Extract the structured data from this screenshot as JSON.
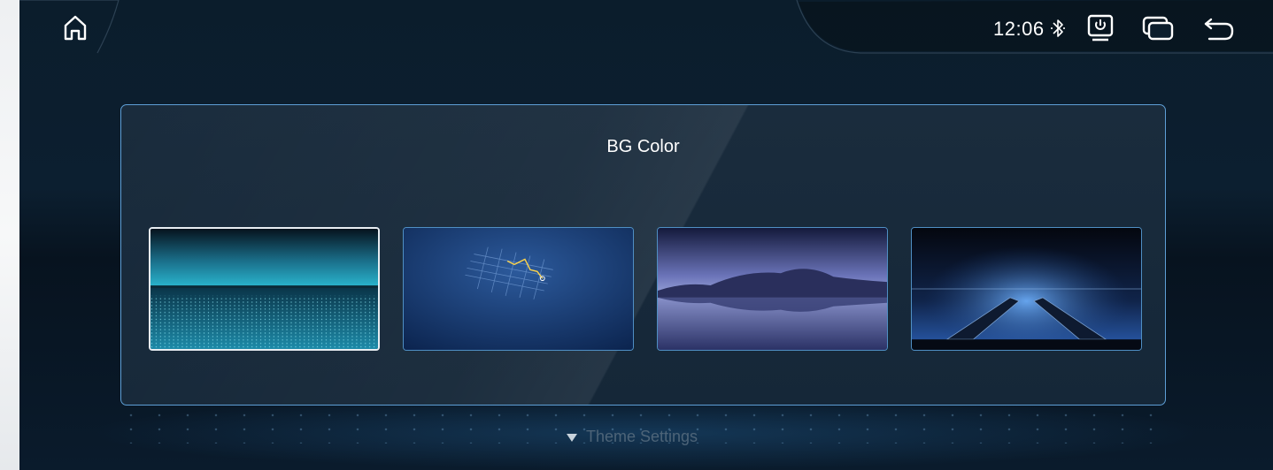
{
  "status_bar": {
    "time": "12:06",
    "icons": [
      "home-icon",
      "bluetooth-icon",
      "screen-power-icon",
      "multi-window-icon",
      "back-icon"
    ]
  },
  "panel": {
    "title": "BG Color",
    "wallpapers": [
      {
        "name": "cyan-horizon-grid",
        "selected": true
      },
      {
        "name": "blue-map-navigation",
        "selected": false
      },
      {
        "name": "purple-mountain-lake",
        "selected": false
      },
      {
        "name": "blue-highway-glow",
        "selected": false
      }
    ]
  },
  "footer": {
    "label": "Theme Settings"
  },
  "colors": {
    "accent_border": "#5e9fd6",
    "selected_border": "#e8edf2",
    "panel_bg": "#1a2c3d",
    "footer_text": "#4d6478"
  }
}
